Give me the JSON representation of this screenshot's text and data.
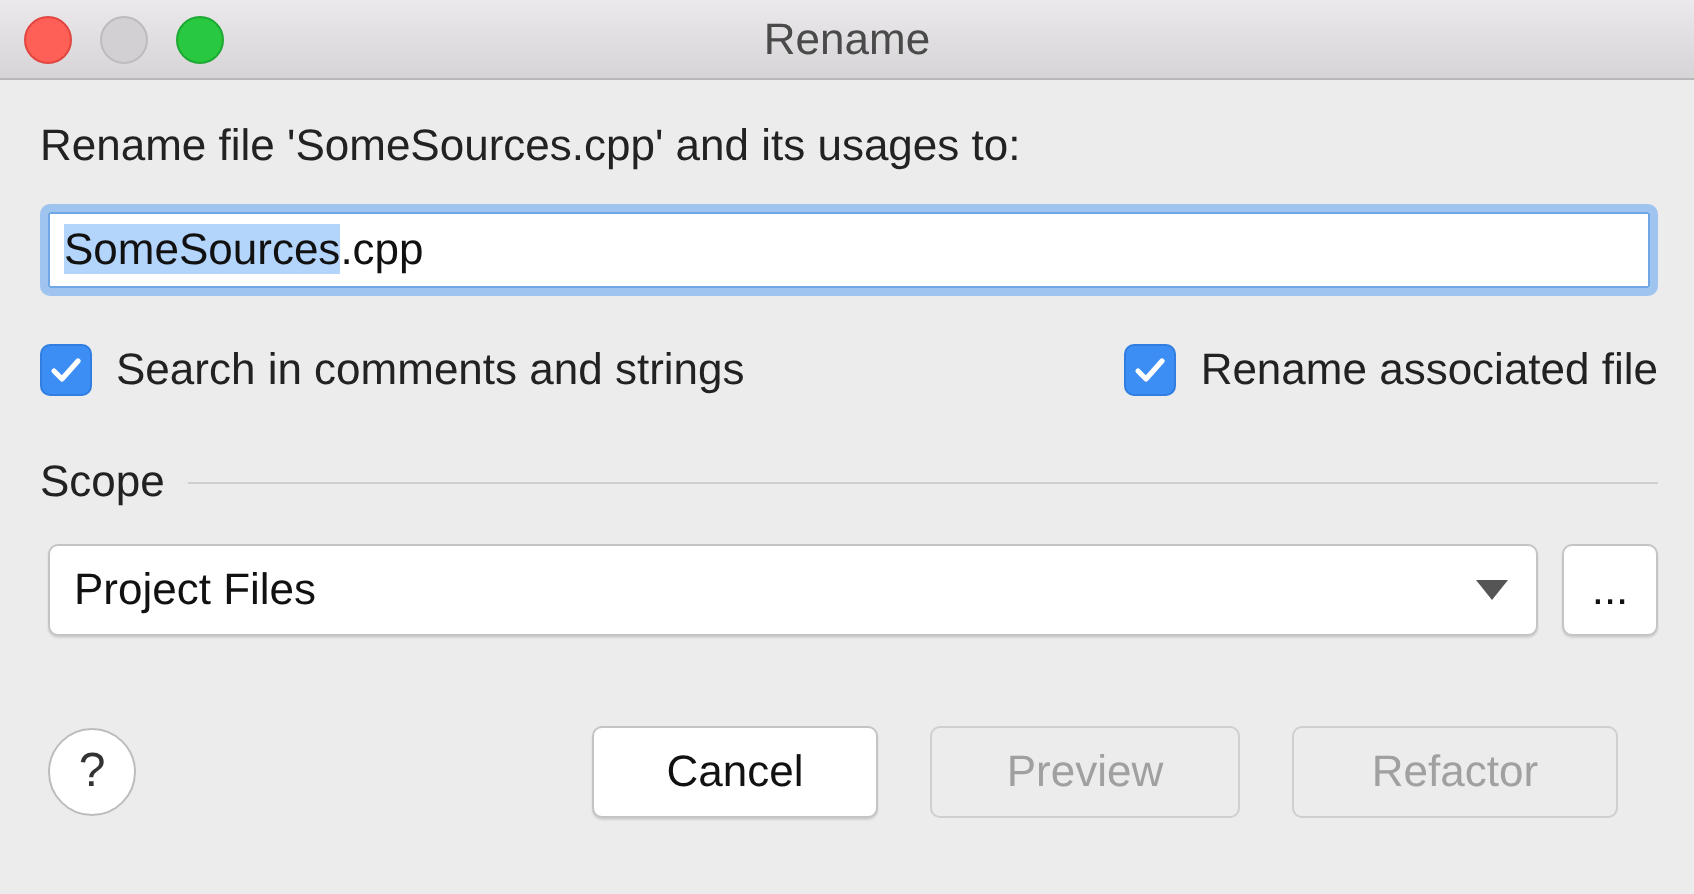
{
  "window": {
    "title": "Rename"
  },
  "prompt": "Rename file 'SomeSources.cpp' and its usages to:",
  "name_field": {
    "selected_part": "SomeSources",
    "unselected_part": ".cpp",
    "focused": true
  },
  "options": [
    {
      "label": "Search in comments and strings",
      "checked": true
    },
    {
      "label": "Rename associated file",
      "checked": true
    }
  ],
  "scope": {
    "label": "Scope",
    "value": "Project Files",
    "more": "..."
  },
  "buttons": [
    {
      "label": "Cancel",
      "disabled": false
    },
    {
      "label": "Preview",
      "disabled": true
    },
    {
      "label": "Refactor",
      "disabled": true
    }
  ],
  "help": "?"
}
